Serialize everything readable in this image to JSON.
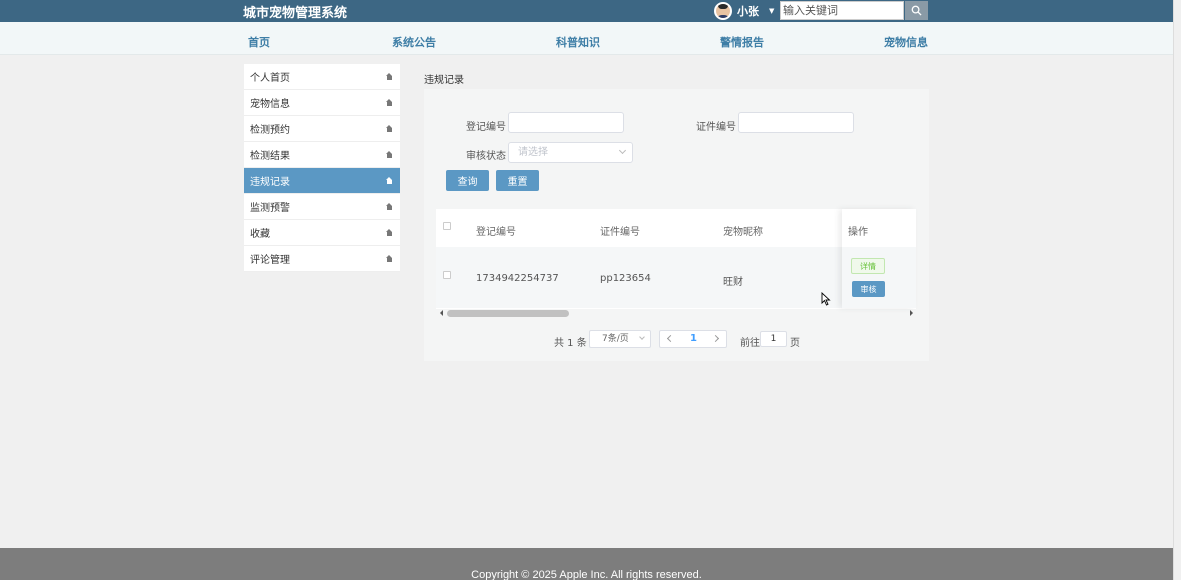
{
  "header": {
    "brand": "城市宠物管理系统",
    "user_name": "小张",
    "search_placeholder": "输入关键词"
  },
  "nav": [
    "首页",
    "系统公告",
    "科普知识",
    "警情报告",
    "宠物信息"
  ],
  "sidebar": {
    "items": [
      {
        "label": "个人首页",
        "active": false
      },
      {
        "label": "宠物信息",
        "active": false
      },
      {
        "label": "检测预约",
        "active": false
      },
      {
        "label": "检测结果",
        "active": false
      },
      {
        "label": "违规记录",
        "active": true
      },
      {
        "label": "监测预警",
        "active": false
      },
      {
        "label": "收藏",
        "active": false
      },
      {
        "label": "评论管理",
        "active": false
      }
    ]
  },
  "main": {
    "title": "违规记录",
    "filters": {
      "reg_no_label": "登记编号",
      "cert_no_label": "证件编号",
      "status_label": "审核状态",
      "status_placeholder": "请选择",
      "query_button": "查询",
      "reset_button": "重置"
    },
    "table": {
      "columns": [
        "登记编号",
        "证件编号",
        "宠物昵称",
        "操作"
      ],
      "rows": [
        {
          "reg_no": "1734942254737",
          "cert_no": "pp123654",
          "pet_name": "旺财",
          "actions": [
            "详情",
            "审核"
          ]
        }
      ]
    },
    "pagination": {
      "total_text": "共 1 条",
      "page_size": "7条/页",
      "current_page": "1",
      "goto_label": "前往",
      "goto_value": "1",
      "page_unit": "页"
    }
  },
  "footer": {
    "text": "Copyright © 2025 Apple Inc. All rights reserved."
  },
  "colors": {
    "header_bg": "#3d6784",
    "accent": "#5b98c4",
    "nav_text": "#3e7ea6",
    "footer_bg": "#7d7d7d"
  }
}
